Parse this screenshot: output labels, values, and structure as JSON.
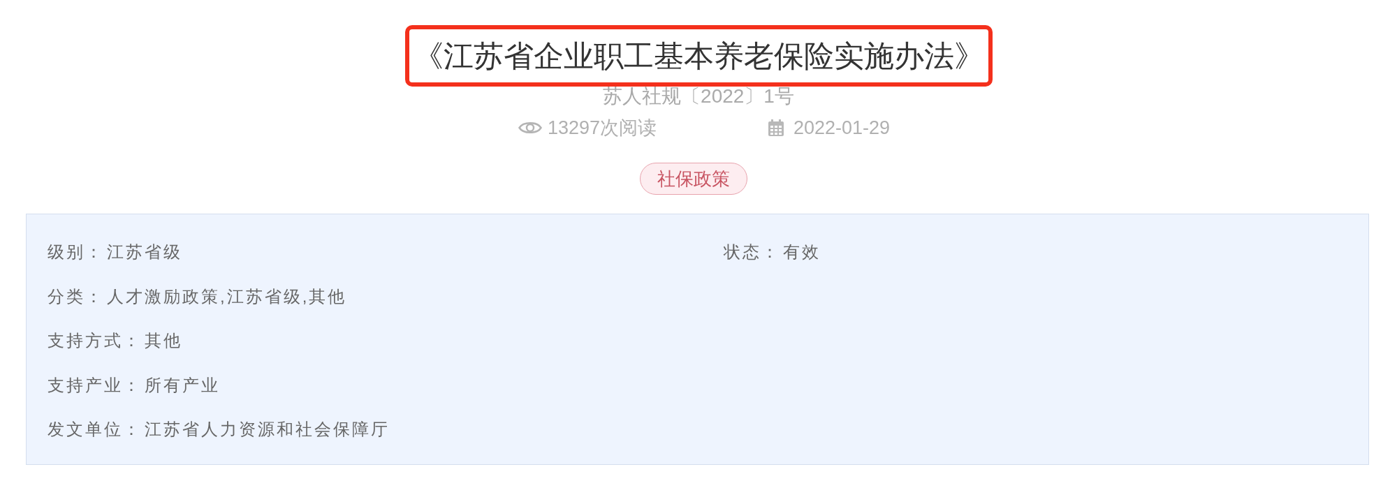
{
  "article": {
    "title": "《江苏省企业职工基本养老保险实施办法》",
    "highlighted": true,
    "doc_number": "苏人社规〔2022〕1号",
    "views": "13297次阅读",
    "date": "2022-01-29",
    "tags": [
      "社保政策"
    ]
  },
  "info": {
    "rows": [
      [
        {
          "label": "级别：",
          "value": "江苏省级"
        },
        {
          "label": "状态：",
          "value": "有效"
        }
      ],
      [
        {
          "label": "分类：",
          "value": "人才激励政策,江苏省级,其他"
        }
      ],
      [
        {
          "label": "支持方式：",
          "value": "其他"
        }
      ],
      [
        {
          "label": "支持产业：",
          "value": "所有产业"
        }
      ],
      [
        {
          "label": "发文单位：",
          "value": "江苏省人力资源和社会保障厅"
        }
      ]
    ]
  }
}
